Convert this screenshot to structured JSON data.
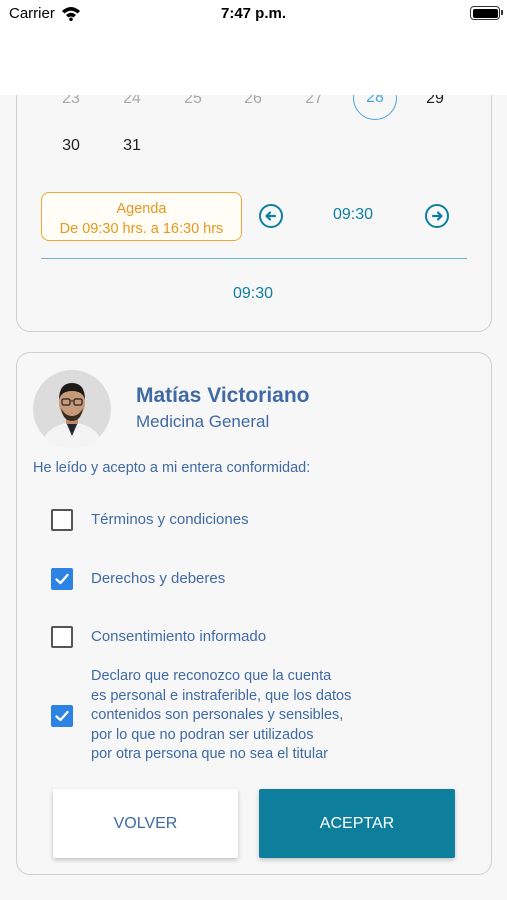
{
  "status_bar": {
    "carrier": "Carrier",
    "time": "7:47 p.m."
  },
  "calendar": {
    "row1": [
      "23",
      "24",
      "25",
      "26",
      "27"
    ],
    "selected_day": "28",
    "row1_after": "29",
    "row2": [
      "30",
      "31"
    ],
    "agenda_title": "Agenda",
    "agenda_hours": "De 09:30 hrs. a 16:30 hrs",
    "slot_time": "09:30",
    "selected_time": "09:30"
  },
  "doctor": {
    "name": "Matías Victoriano",
    "specialty": "Medicina General"
  },
  "consent": {
    "intro": "He leído y acepto a mi entera conformidad:",
    "items": [
      {
        "label": "Términos y condiciones",
        "checked": false
      },
      {
        "label": "Derechos y deberes",
        "checked": true
      },
      {
        "label": "Consentimiento informado",
        "checked": false
      }
    ],
    "declaration": {
      "checked": true,
      "lines": [
        "Declaro que reconozco que la cuenta",
        "es  personal e instraferible, que los datos",
        "contenidos son personales y sensibles,",
        "por lo que no podran ser utilizados",
        "por otra persona que no sea el titular"
      ]
    }
  },
  "buttons": {
    "back": "VOLVER",
    "accept": "ACEPTAR"
  },
  "colors": {
    "accent": "#0d7f9c",
    "text_blue": "#3f6aa4",
    "agenda_orange": "#f0a63a",
    "checkbox_blue": "#2c83e3"
  }
}
